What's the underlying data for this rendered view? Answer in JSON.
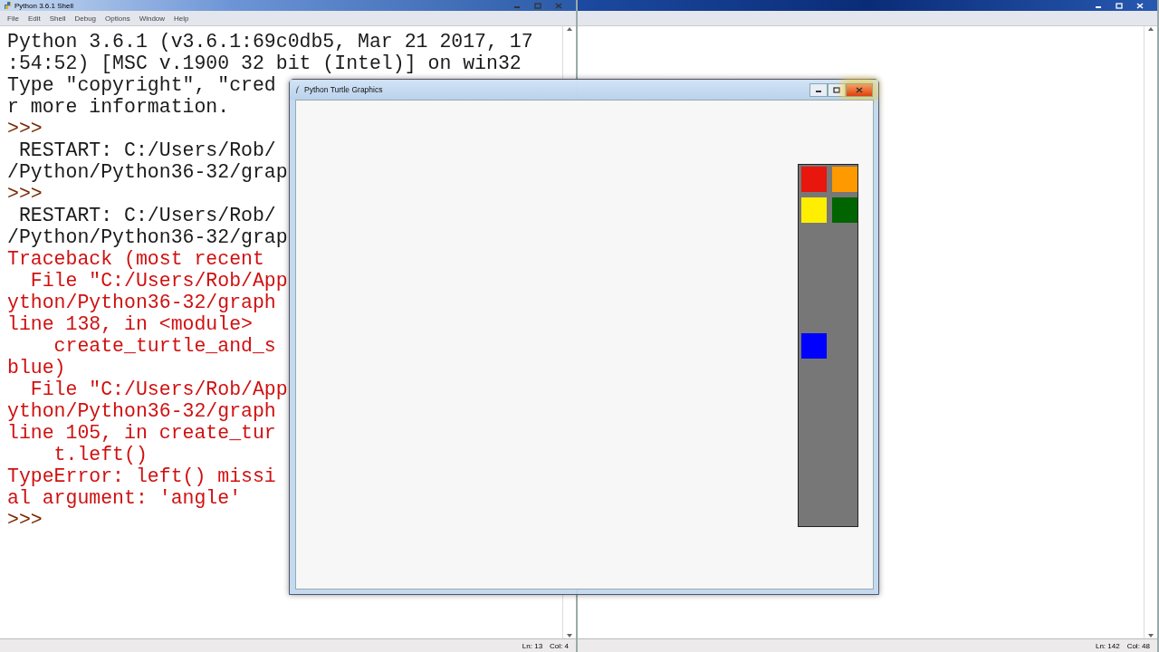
{
  "shell_window": {
    "title": "Python 3.6.1 Shell",
    "menu": [
      "File",
      "Edit",
      "Shell",
      "Debug",
      "Options",
      "Window",
      "Help"
    ],
    "lines": [
      {
        "kind": "output",
        "text": "Python 3.6.1 (v3.6.1:69c0db5, Mar 21 2017, 17"
      },
      {
        "kind": "output",
        "text": ":54:52) [MSC v.1900 32 bit (Intel)] on win32"
      },
      {
        "kind": "output",
        "text": "Type \"copyright\", \"cred"
      },
      {
        "kind": "output",
        "text": "r more information."
      },
      {
        "kind": "prompt",
        "text": ">>>"
      },
      {
        "kind": "output",
        "text": " RESTART: C:/Users/Rob/"
      },
      {
        "kind": "output",
        "text": "/Python/Python36-32/grap"
      },
      {
        "kind": "prompt",
        "text": ">>>"
      },
      {
        "kind": "output",
        "text": " RESTART: C:/Users/Rob/"
      },
      {
        "kind": "output",
        "text": "/Python/Python36-32/grap"
      },
      {
        "kind": "error",
        "text": "Traceback (most recent"
      },
      {
        "kind": "error",
        "text": "  File \"C:/Users/Rob/App"
      },
      {
        "kind": "error",
        "text": "ython/Python36-32/graph"
      },
      {
        "kind": "error",
        "text": "line 138, in <module>"
      },
      {
        "kind": "error",
        "text": "    create_turtle_and_s"
      },
      {
        "kind": "error",
        "text": "blue)"
      },
      {
        "kind": "error",
        "text": "  File \"C:/Users/Rob/App"
      },
      {
        "kind": "error",
        "text": "ython/Python36-32/graph"
      },
      {
        "kind": "error",
        "text": "line 105, in create_tur"
      },
      {
        "kind": "error",
        "text": "    t.left()"
      },
      {
        "kind": "error",
        "text": "TypeError: left() missi"
      },
      {
        "kind": "error",
        "text": "al argument: 'angle'"
      },
      {
        "kind": "prompt",
        "text": ">>>"
      }
    ],
    "status": {
      "line": "Ln: 13",
      "col": "Col: 4"
    }
  },
  "editor_window": {
    "status": {
      "line": "Ln: 142",
      "col": "Col: 48"
    }
  },
  "turtle_window": {
    "title": "Python Turtle Graphics",
    "close_hovered": true,
    "palette": [
      {
        "color": "#e8160c"
      },
      {
        "color": "#ff9900"
      },
      {
        "color": "#ffee00"
      },
      {
        "color": "#006400"
      }
    ],
    "marker": {
      "color": "#0000ff"
    }
  }
}
